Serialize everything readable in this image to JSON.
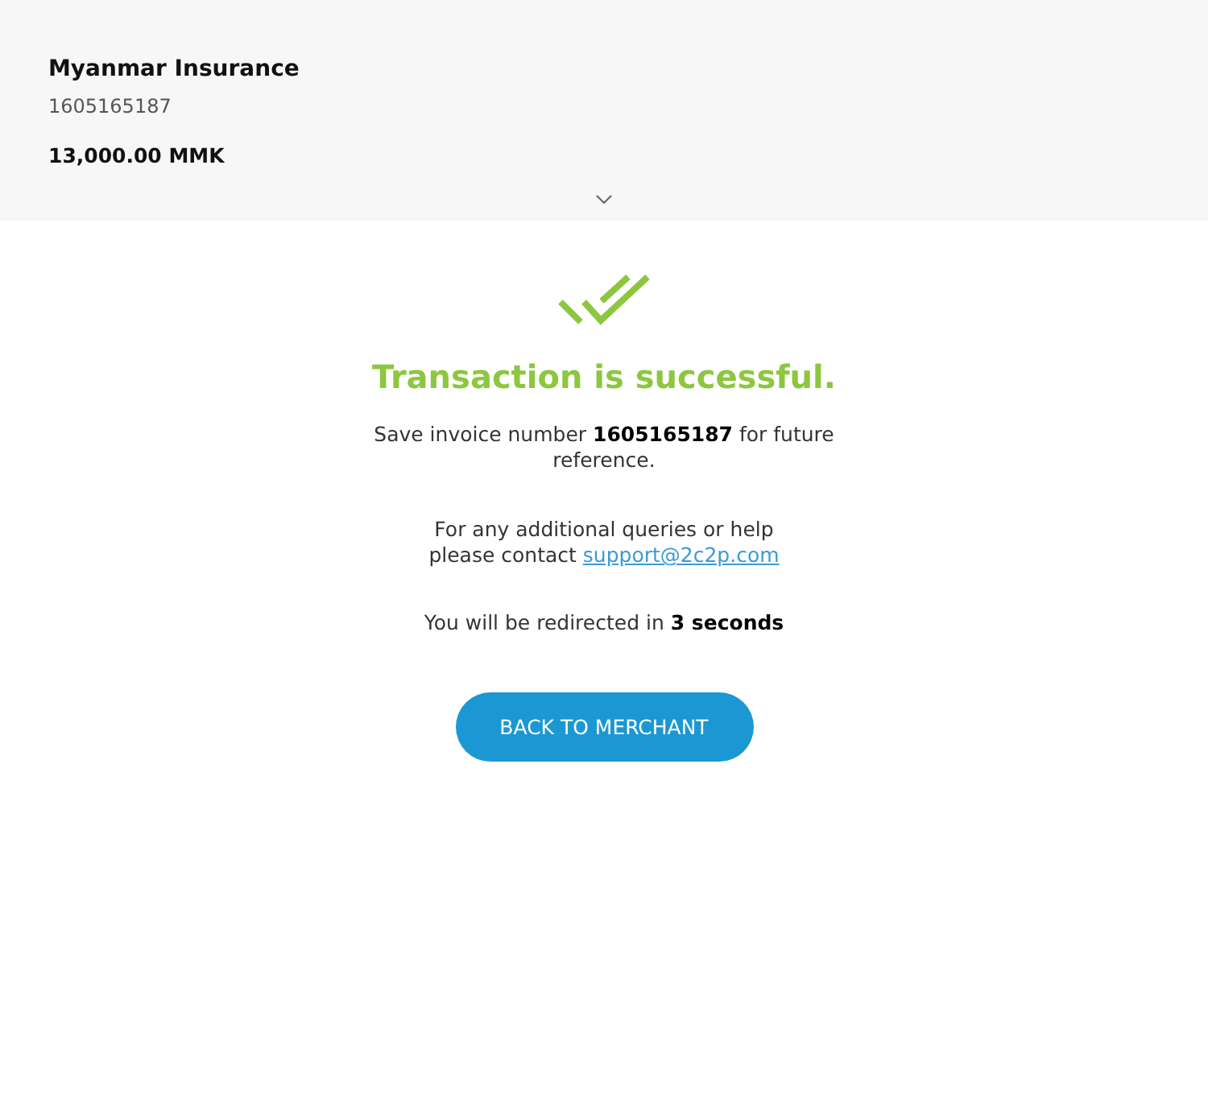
{
  "summary": {
    "merchant_name": "Myanmar Insurance",
    "invoice_number": "1605165187",
    "amount": "13,000.00 MMK"
  },
  "result": {
    "title": "Transaction is successful.",
    "invoice_note": "Save invoice number **1605165187** for future reference.",
    "help_text": "For any additional queries or help please contact",
    "support_email": "support@2c2p.com",
    "redirect_note": "You will be redirected in **3 seconds**"
  },
  "button": {
    "label": "BACK TO MERCHANT"
  }
}
